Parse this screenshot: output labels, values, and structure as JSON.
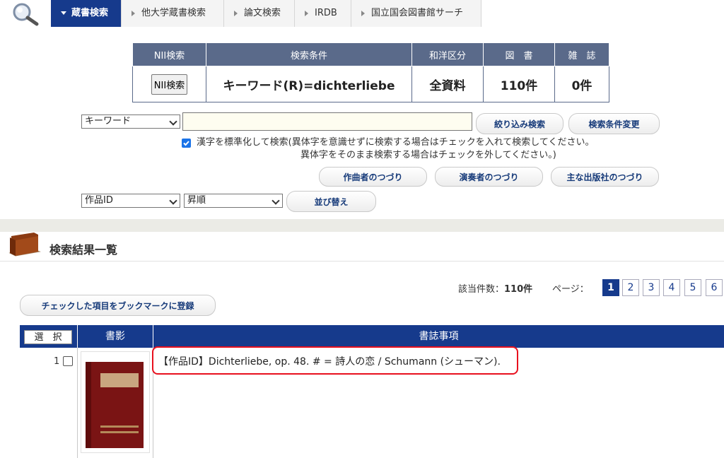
{
  "tabs": [
    {
      "label": "蔵書検索",
      "active": true
    },
    {
      "label": "他大学蔵書検索",
      "active": false
    },
    {
      "label": "論文検索",
      "active": false
    },
    {
      "label": "IRDB",
      "active": false
    },
    {
      "label": "国立国会図書館サーチ",
      "active": false
    }
  ],
  "conditions": {
    "headers": [
      "NII検索",
      "検索条件",
      "和洋区分",
      "図　書",
      "雑　誌"
    ],
    "nii_button": "NII検索",
    "query": "キーワード(R)=dichterliebe",
    "language": "全資料",
    "books": "110件",
    "journals": "0件"
  },
  "search": {
    "field_select": "キーワード",
    "keyword_value": "",
    "refine_button": "絞り込み検索",
    "change_button": "検索条件変更",
    "normalize_label": "漢字を標準化して検索",
    "normalize_checked": true,
    "note_line1": "(異体字を意識せずに検索する場合はチェックを入れて検索してください。",
    "note_line2": "異体字をそのまま検索する場合はチェックを外してください。)",
    "composer_button": "作曲者のつづり",
    "performer_button": "演奏者のつづり",
    "publisher_button": "主な出版社のつづり",
    "sort_field": "作品ID",
    "sort_order": "昇順",
    "sort_button": "並び替え"
  },
  "results": {
    "title": "検索結果一覧",
    "count_label": "該当件数：",
    "count_value": "110件",
    "page_label": "ページ：",
    "pages": [
      "1",
      "2",
      "3",
      "4",
      "5",
      "6"
    ],
    "current_page": "1",
    "bookmark_button": "チェックした項目をブックマークに登録",
    "columns": {
      "select": "選　択",
      "cover": "書影",
      "bib": "書誌事項"
    },
    "rows": [
      {
        "num": "1",
        "text": "【作品ID】Dichterliebe, op. 48. # = 詩人の恋 / Schumann (シューマン)."
      }
    ]
  },
  "colors": {
    "nav_active": "#163a8c",
    "header_gray": "#5a6a8a",
    "highlight": "#e8101e"
  }
}
